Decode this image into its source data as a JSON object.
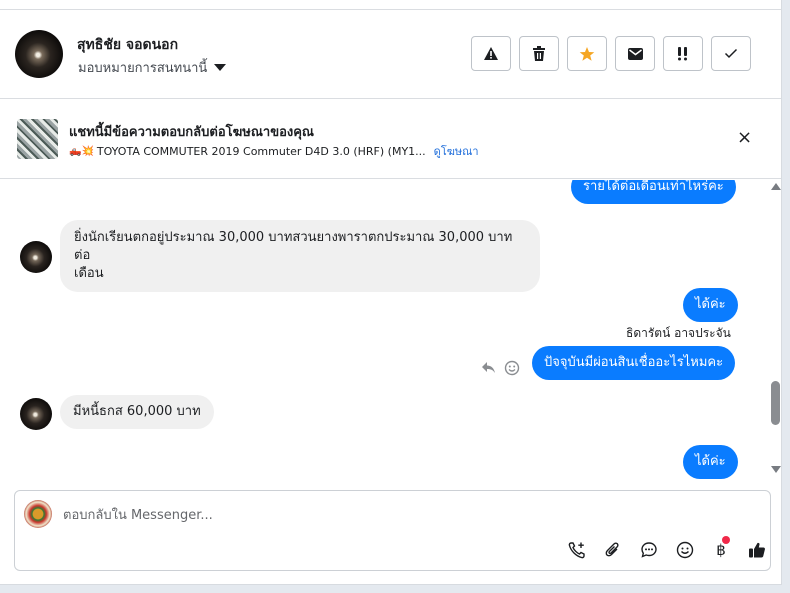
{
  "contact": {
    "name": "สุทธิชัย จอดนอก",
    "assign_label": "มอบหมายการสนทนานี้"
  },
  "toolbar": {
    "spam": "⚠",
    "delete": "🗑",
    "star": "★",
    "mail": "✉",
    "follow_up": "!!",
    "done": "✓"
  },
  "ad_banner": {
    "title": "แชทนี้มีข้อความตอบกลับต่อโฆษณาของคุณ",
    "emoji": "🛻💥",
    "ad_text": "TOYOTA COMMUTER 2019 Commuter D4D 3.0 (HRF) (MY1...",
    "view_ad_link": "ดูโฆษณา",
    "close": "×"
  },
  "messages": {
    "m1": "รายได้ต่อเดือนเท่าไหร่คะ",
    "m2": "ยิ่งนักเรียนตกอยู่ประมาณ 30,000 บาทสวนยางพาราตกประมาณ 30,000 บาทต่อ",
    "m2b": "เดือน",
    "m3": "ได้ค่ะ",
    "sender": "ธิดารัตน์ อาจประจัน",
    "m4": "ปัจจุบันมีผ่อนสินเชื่ออะไรไหมคะ",
    "m5": "มีหนี้ธกส 60,000 บาท",
    "m6": "ได้ค่ะ"
  },
  "composer": {
    "placeholder": "ตอบกลับใน Messenger...",
    "baht_symbol": "฿"
  },
  "colors": {
    "accent": "#0a7cff",
    "star": "#f5a623",
    "link": "#216fdb",
    "badge": "#f02849"
  }
}
